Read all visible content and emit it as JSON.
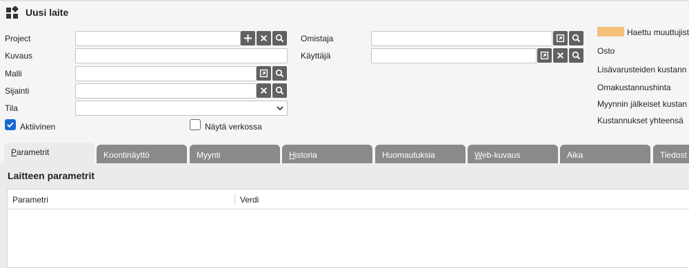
{
  "header": {
    "title": "Uusi laite"
  },
  "form": {
    "project": {
      "label": "Project",
      "value": ""
    },
    "kuvaus": {
      "label": "Kuvaus",
      "value": ""
    },
    "malli": {
      "label": "Malli",
      "value": ""
    },
    "sijainti": {
      "label": "Sijainti",
      "value": ""
    },
    "tila": {
      "label": "Tila",
      "value": ""
    },
    "aktiivinen": {
      "label": "Aktiivinen",
      "checked": true
    },
    "nayta_verkossa": {
      "label": "Näytä verkossa",
      "checked": false
    },
    "omistaja": {
      "label": "Omistaja",
      "value": ""
    },
    "kayttaja": {
      "label": "Käyttäjä",
      "value": ""
    }
  },
  "costs": {
    "legend_label": "Haettu muuttujist",
    "legend_color": "#f4c07a",
    "rows": [
      "Osto",
      "Lisävarusteiden kustann",
      "Omakustannushinta",
      "Myynnin jälkeiset kustan",
      "Kustannukset yhteensä"
    ]
  },
  "tabs": [
    {
      "underline": "P",
      "rest": "arametrit",
      "active": true
    },
    {
      "underline": "",
      "rest": "Koontinäyttö",
      "active": false
    },
    {
      "underline": "",
      "rest": "Myynti",
      "active": false
    },
    {
      "underline": "H",
      "rest": "istoria",
      "active": false
    },
    {
      "underline": "",
      "rest": "Huomautuksia",
      "active": false
    },
    {
      "underline": "W",
      "rest": "eb-kuvaus",
      "active": false
    },
    {
      "underline": "",
      "rest": "Aika",
      "active": false
    },
    {
      "underline": "",
      "rest": "Tiedost",
      "active": false
    }
  ],
  "section": {
    "title": "Laitteen parametrit",
    "columns": [
      "Parametri",
      "Verdi"
    ]
  },
  "icons": {
    "title": "widgets-icon",
    "add": "plus-icon",
    "clear": "x-icon",
    "search": "magnifier-icon",
    "open": "open-external-icon",
    "dropdown": "chevron-down-icon",
    "check": "checkmark-icon"
  }
}
